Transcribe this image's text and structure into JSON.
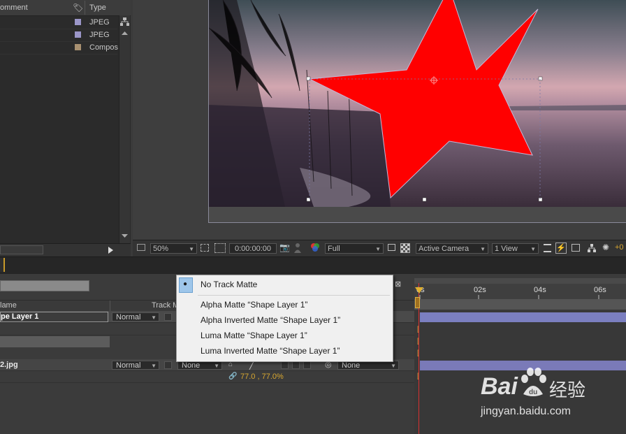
{
  "project": {
    "col_comment": "omment",
    "col_type": "Type",
    "rows": [
      {
        "type": "JPEG",
        "color": "#9b96c8"
      },
      {
        "type": "JPEG",
        "color": "#9b96c8"
      },
      {
        "type": "Compos",
        "color": "#a89070"
      }
    ]
  },
  "viewer_toolbar": {
    "zoom": "50%",
    "timecode": "0:00:00:00",
    "resolution": "Full",
    "camera": "Active Camera",
    "view": "1 View"
  },
  "timeline": {
    "col_name": "lame",
    "col_track_matte": "Track Ma",
    "layers": [
      {
        "name": "pe Layer 1",
        "mode": "Normal"
      },
      {
        "name": "2.jpg",
        "mode": "Normal",
        "matte": "None",
        "parent": "None",
        "scale": "77.0 , 77.0%"
      }
    ],
    "time_marks": [
      "0s",
      "02s",
      "04s",
      "06s"
    ]
  },
  "track_matte_menu": {
    "items": [
      "No Track Matte",
      "Alpha Matte “Shape Layer 1”",
      "Alpha Inverted Matte “Shape Layer 1”",
      "Luma Matte “Shape Layer 1”",
      "Luma Inverted Matte “Shape Layer 1”"
    ],
    "selected_index": 0
  },
  "watermark": {
    "brand": "Bai",
    "brand2": "du",
    "cn": "经验",
    "url": "jingyan.baidu.com"
  },
  "colors": {
    "star": "#ff0000",
    "accent": "#c89a2a",
    "bar": "#7a7ab8",
    "playhead": "#d83030"
  }
}
